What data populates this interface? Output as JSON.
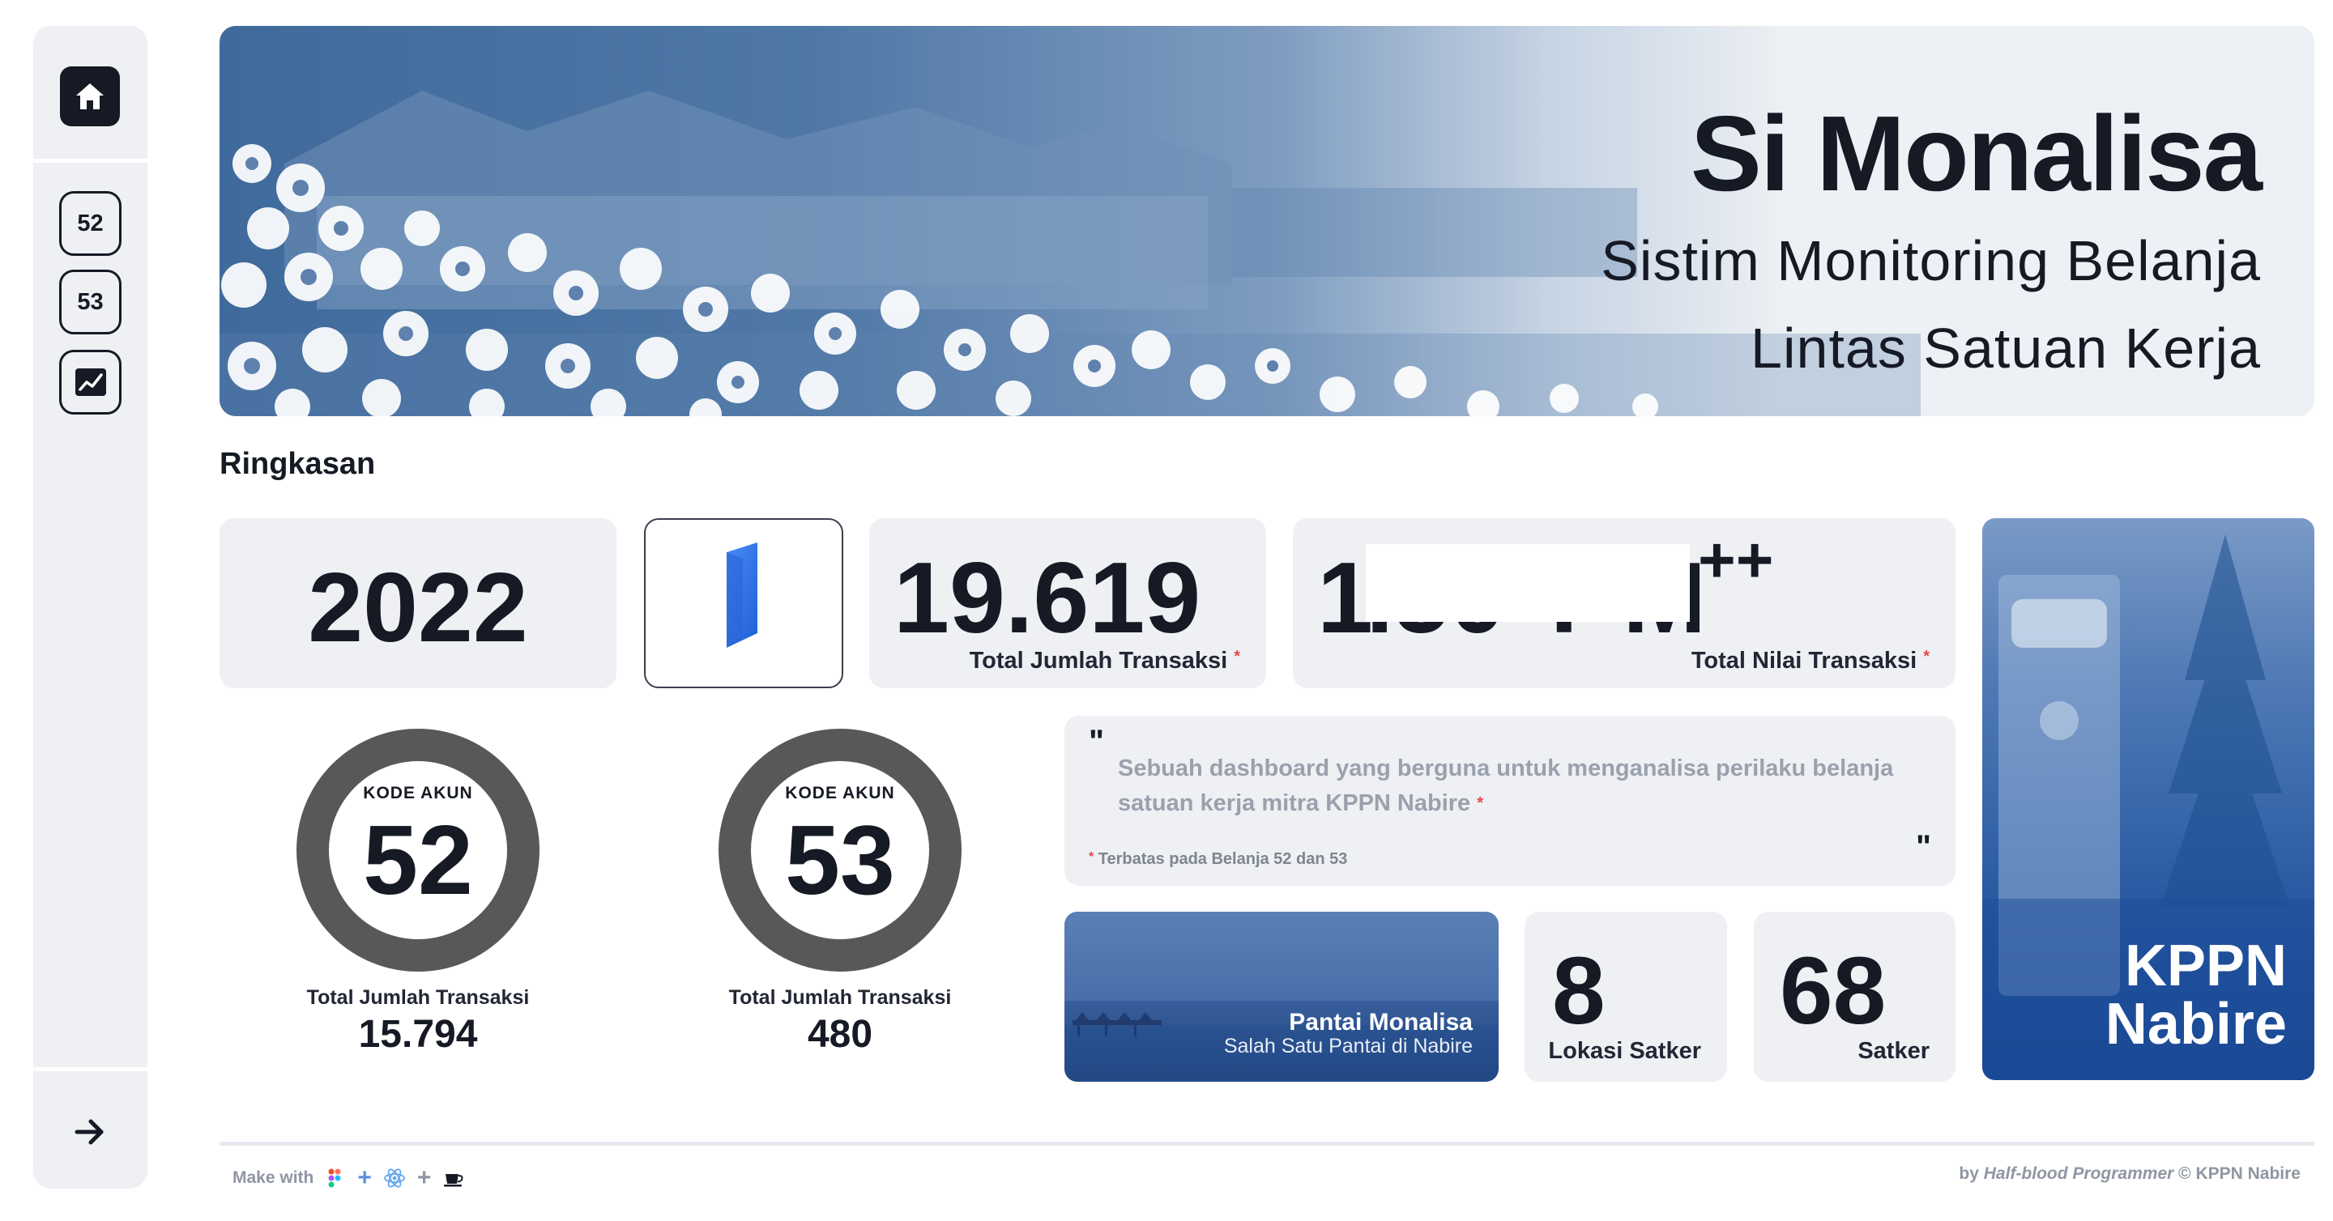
{
  "sidebar": {
    "home_icon": "home-icon",
    "items": [
      {
        "label": "52"
      },
      {
        "label": "53"
      },
      {
        "icon": "chart-line-icon"
      }
    ],
    "collapse_icon": "arrow-right-icon"
  },
  "hero": {
    "title": "Si Monalisa",
    "subtitle_line1": "Sistim Monitoring Belanja",
    "subtitle_line2": "Lintas Satuan Kerja"
  },
  "section_title": "Ringkasan",
  "summary": {
    "year": "2022",
    "total_transactions": "19.619",
    "total_transactions_label": "Total Jumlah Transaksi",
    "total_value_visible_prefix": "1",
    "total_value_visible_suffix": "++",
    "total_value_label": "Total Nilai Transaksi"
  },
  "accounts": [
    {
      "kode_label": "KODE AKUN",
      "kode": "52",
      "total_label": "Total Jumlah Transaksi",
      "total": "15.794"
    },
    {
      "kode_label": "KODE AKUN",
      "kode": "53",
      "total_label": "Total Jumlah Transaksi",
      "total": "480"
    }
  ],
  "quote": {
    "open": "\"",
    "close": "\"",
    "text": "Sebuah dashboard yang berguna untuk menganalisa perilaku belanja satuan kerja mitra KPPN Nabire",
    "note": "Terbatas pada Belanja 52 dan 53"
  },
  "pantai": {
    "title": "Pantai Monalisa",
    "subtitle": "Salah Satu Pantai di Nabire"
  },
  "stats": [
    {
      "value": "8",
      "label": "Lokasi Satker"
    },
    {
      "value": "68",
      "label": "Satker"
    }
  ],
  "kppn": {
    "line1": "KPPN",
    "line2": "Nabire"
  },
  "footer": {
    "make_with": "Make with",
    "plus": "+",
    "by": "by",
    "author": "Half-blood Programmer",
    "copyright": "© KPPN Nabire"
  },
  "colors": {
    "dark": "#161a24",
    "card": "#eef0f4",
    "ring": "#585858",
    "accent_red": "#e74a4a",
    "brand_blue": "#2f6fe8"
  }
}
